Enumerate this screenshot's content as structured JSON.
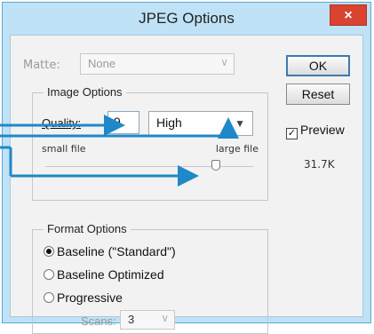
{
  "window": {
    "title": "JPEG Options",
    "close_glyph": "×"
  },
  "matte": {
    "label": "Matte:",
    "value": "None"
  },
  "image_options": {
    "legend": "Image Options",
    "quality_label": "Quality:",
    "quality_value": "9",
    "quality_preset": "High",
    "small_file_label": "small file",
    "large_file_label": "large file",
    "slider_value_fraction": 0.82
  },
  "format_options": {
    "legend": "Format Options",
    "options": [
      "Baseline (\"Standard\")",
      "Baseline Optimized",
      "Progressive"
    ],
    "selected_index": 0,
    "scans_label": "Scans:",
    "scans_value": "3"
  },
  "buttons": {
    "ok": "OK",
    "reset": "Reset"
  },
  "preview": {
    "label": "Preview",
    "checked": true,
    "file_size": "31.7K"
  },
  "annotation_color": "#1e88c8"
}
